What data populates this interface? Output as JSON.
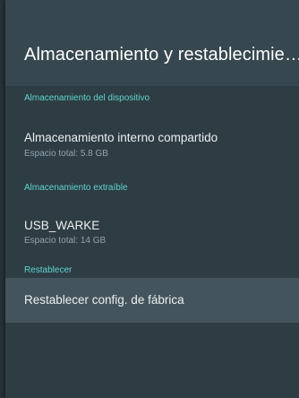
{
  "header": {
    "title": "Almacenamiento y restablecimie…"
  },
  "sections": {
    "device_storage": {
      "header": "Almacenamiento del dispositivo",
      "item_title": "Almacenamiento interno compartido",
      "item_subtitle": "Espacio total: 5.8 GB"
    },
    "removable_storage": {
      "header": "Almacenamiento extraíble",
      "item_title": "USB_WARKE",
      "item_subtitle": "Espacio total: 14 GB"
    },
    "reset": {
      "header": "Restablecer",
      "item_title": "Restablecer config. de fábrica"
    }
  },
  "colors": {
    "accent": "#5fd6d0",
    "panel": "#37474f",
    "list_bg": "#2e3c43",
    "selected": "#44545c"
  }
}
